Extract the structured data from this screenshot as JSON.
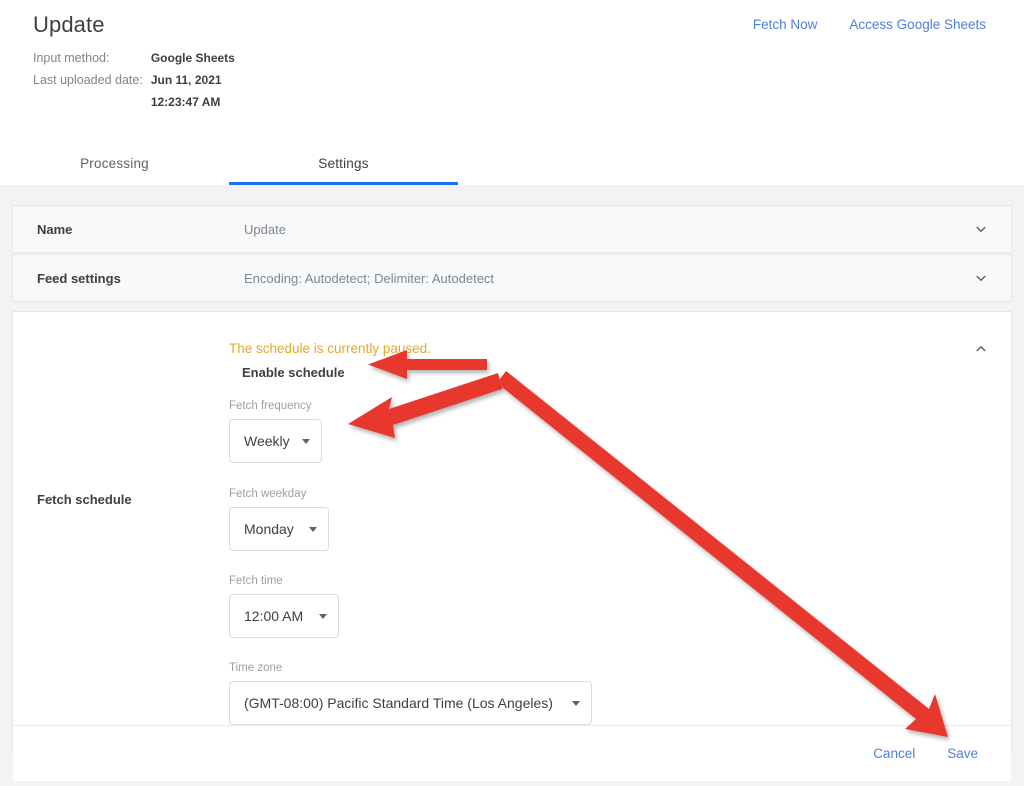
{
  "header": {
    "title": "Update",
    "meta": [
      {
        "label": "Input method:",
        "value": "Google Sheets"
      },
      {
        "label": "Last uploaded date:",
        "value": "Jun 11, 2021"
      },
      {
        "label": "",
        "value": "12:23:47 AM"
      }
    ],
    "actions": [
      {
        "label": "Fetch Now"
      },
      {
        "label": "Access Google Sheets"
      }
    ]
  },
  "tabs": [
    {
      "label": "Processing",
      "active": false
    },
    {
      "label": "Settings",
      "active": true
    }
  ],
  "cards": [
    {
      "title": "Name",
      "summary": "Update",
      "icon": "chevron-down-icon"
    },
    {
      "title": "Feed settings",
      "summary": "Encoding: Autodetect; Delimiter: Autodetect",
      "icon": "chevron-down-icon"
    }
  ],
  "schedule": {
    "title": "Fetch schedule",
    "paused_message": "The schedule is currently paused.",
    "enable_label": "Enable schedule",
    "collapse_icon": "chevron-up-icon",
    "fields": [
      {
        "label": "Fetch frequency",
        "value": "Weekly"
      },
      {
        "label": "Fetch weekday",
        "value": "Monday"
      },
      {
        "label": "Fetch time",
        "value": "12:00 AM"
      },
      {
        "label": "Time zone",
        "value": "(GMT-08:00) Pacific Standard Time (Los Angeles)"
      }
    ]
  },
  "footer": {
    "cancel_label": "Cancel",
    "save_label": "Save"
  },
  "colors": {
    "accent_blue": "#1a73e8",
    "link_blue": "#4d7fe0",
    "warning_amber": "#e0a82e",
    "annotation_red": "#e8372e",
    "page_background": "#f1f3f4",
    "card_background": "#f8f9fa"
  },
  "annotations": [
    {
      "name": "arrow-to-enable-schedule",
      "color": "#e8372e"
    },
    {
      "name": "arrow-to-fetch-frequency",
      "color": "#e8372e"
    },
    {
      "name": "arrow-to-save-button",
      "color": "#e8372e"
    }
  ]
}
